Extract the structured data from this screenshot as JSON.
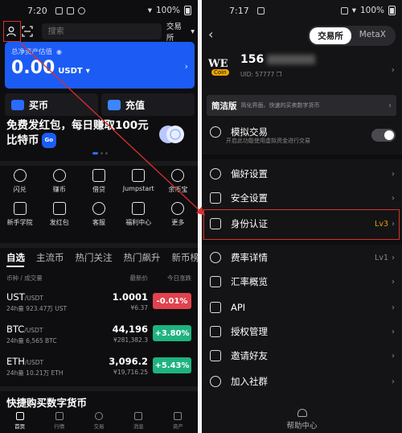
{
  "left": {
    "status": {
      "time": "7:20",
      "battery": "100%"
    },
    "search_placeholder": "搜索",
    "exchange_dropdown": "交易所",
    "asset": {
      "label": "总净资产估值",
      "value": "0.00",
      "unit": "USDT"
    },
    "actions": [
      {
        "label": "买币"
      },
      {
        "label": "充值"
      }
    ],
    "promo": {
      "line1": "免费发红包，每日赚取100元",
      "line2": "比特币",
      "badge": "Go"
    },
    "grid": [
      {
        "label": "闪兑",
        "icon": "swap-icon"
      },
      {
        "label": "赚币",
        "icon": "earn-icon"
      },
      {
        "label": "借贷",
        "icon": "loan-icon"
      },
      {
        "label": "Jumpstart",
        "icon": "jumpstart-icon"
      },
      {
        "label": "余币宝",
        "icon": "savings-icon"
      },
      {
        "label": "新手学院",
        "icon": "academy-icon"
      },
      {
        "label": "发红包",
        "icon": "red-packet-icon"
      },
      {
        "label": "客服",
        "icon": "support-icon"
      },
      {
        "label": "福利中心",
        "icon": "gift-icon"
      },
      {
        "label": "更多",
        "icon": "more-icon"
      }
    ],
    "tabs": [
      "自选",
      "主流币",
      "热门关注",
      "热门飙升",
      "新币榜"
    ],
    "market_header": {
      "col1": "币种 / 成交量",
      "col2": "最新价",
      "col3": "今日涨跌"
    },
    "markets": [
      {
        "base": "UST",
        "quote": "/USDT",
        "volume": "24h量 923.47万 UST",
        "price": "1.0001",
        "price_cny": "¥6.37",
        "change": "-0.01%",
        "up": false
      },
      {
        "base": "BTC",
        "quote": "/USDT",
        "volume": "24h量 6,565 BTC",
        "price": "44,196",
        "price_cny": "¥281,382.3",
        "change": "+3.80%",
        "up": true
      },
      {
        "base": "ETH",
        "quote": "/USDT",
        "volume": "24h量 10.21万 ETH",
        "price": "3,096.2",
        "price_cny": "¥19,716.25",
        "change": "+5.43%",
        "up": true
      }
    ],
    "quickbuy": "快捷购买数字货币",
    "nav": [
      "首页",
      "行情",
      "交易",
      "消息",
      "资产"
    ]
  },
  "right": {
    "status": {
      "time": "7:17",
      "battery": "100%"
    },
    "segments": [
      "交易所",
      "MetaX"
    ],
    "logo": {
      "top": "WE",
      "bottom": "Coin"
    },
    "uid_main": "156",
    "uid_sub": "UID: 57777",
    "simple": {
      "title": "简洁版",
      "desc": "简化界面、快速的买卖数字货币"
    },
    "sim_trade": {
      "label": "模拟交易",
      "desc": "开启此功能使用虚拟资金进行交易"
    },
    "menu1": [
      {
        "label": "偏好设置",
        "icon": "gear-icon"
      },
      {
        "label": "安全设置",
        "icon": "shield-icon"
      }
    ],
    "kyc": {
      "label": "身份认证",
      "value": "Lv3",
      "icon": "id-card-icon"
    },
    "menu2": [
      {
        "label": "费率详情",
        "value": "Lv1",
        "icon": "fee-icon"
      },
      {
        "label": "汇率概览",
        "value": "",
        "icon": "exchange-rate-icon"
      },
      {
        "label": "API",
        "value": "",
        "icon": "api-icon"
      },
      {
        "label": "授权管理",
        "value": "",
        "icon": "authorize-icon"
      },
      {
        "label": "邀请好友",
        "value": "",
        "icon": "share-icon"
      },
      {
        "label": "加入社群",
        "value": "",
        "icon": "community-icon"
      }
    ],
    "help": "帮助中心"
  },
  "colors": {
    "accent_blue": "#1c5cf5",
    "up_green": "#1fb380",
    "down_red": "#e0424e",
    "highlight_red": "#d6302c",
    "gold": "#e0a200"
  }
}
